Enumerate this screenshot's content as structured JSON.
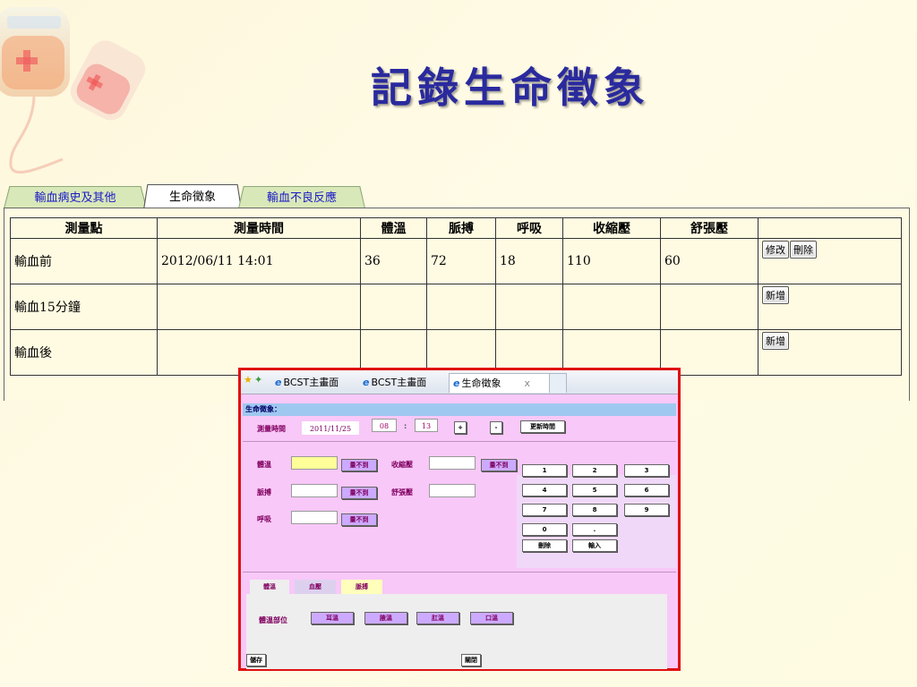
{
  "slide": {
    "title": "記錄生命徵象"
  },
  "tabs": [
    {
      "label": "輸血病史及其他",
      "active": false
    },
    {
      "label": "生命徵象",
      "active": true
    },
    {
      "label": "輸血不良反應",
      "active": false
    }
  ],
  "table": {
    "headers": [
      "測量點",
      "測量時間",
      "體溫",
      "脈搏",
      "呼吸",
      "收縮壓",
      "舒張壓",
      ""
    ],
    "rows": [
      {
        "point": "輸血前",
        "time": "2012/06/11 14:01",
        "temp": "36",
        "pulse": "72",
        "resp": "18",
        "sys": "110",
        "dia": "60",
        "actions": [
          "修改",
          "刪除"
        ]
      },
      {
        "point": "輸血15分鐘",
        "time": "",
        "temp": "",
        "pulse": "",
        "resp": "",
        "sys": "",
        "dia": "",
        "actions": [
          "新增"
        ]
      },
      {
        "point": "輸血後",
        "time": "",
        "temp": "",
        "pulse": "",
        "resp": "",
        "sys": "",
        "dia": "",
        "actions": [
          "新增"
        ]
      }
    ]
  },
  "popup": {
    "browser_tabs": [
      "BCST主畫面",
      "BCST主畫面",
      "生命徵象"
    ],
    "close_glyph": "x",
    "section_title": "生命徵象：",
    "measure_time_label": "測量時間",
    "date_value": "2011/11/25",
    "hour_value": "08",
    "colon": ":",
    "minute_value": "13",
    "plus_label": "+",
    "minus_label": "-",
    "update_time_label": "更新時間",
    "temp_label": "體溫",
    "pulse_label": "脈搏",
    "resp_label": "呼吸",
    "sys_label": "收縮壓",
    "dia_label": "舒張壓",
    "cannot_measure": "量不到",
    "numpad": [
      "1",
      "2",
      "3",
      "4",
      "5",
      "6",
      "7",
      "8",
      "9",
      "0",
      "."
    ],
    "clear_label": "刪除",
    "enter_label": "輸入",
    "sub_tabs": [
      "體溫",
      "血壓",
      "脈搏"
    ],
    "temp_site_label": "體溫部位",
    "temp_sites": [
      "耳溫",
      "腋溫",
      "肛溫",
      "口溫"
    ],
    "save_label": "儲存",
    "close_label": "關閉"
  },
  "colors": {
    "title": "#2a2a9e",
    "popup_border": "#e01010",
    "popup_bg": "#f8c8f8",
    "link_tab": "#1a1ac8"
  }
}
